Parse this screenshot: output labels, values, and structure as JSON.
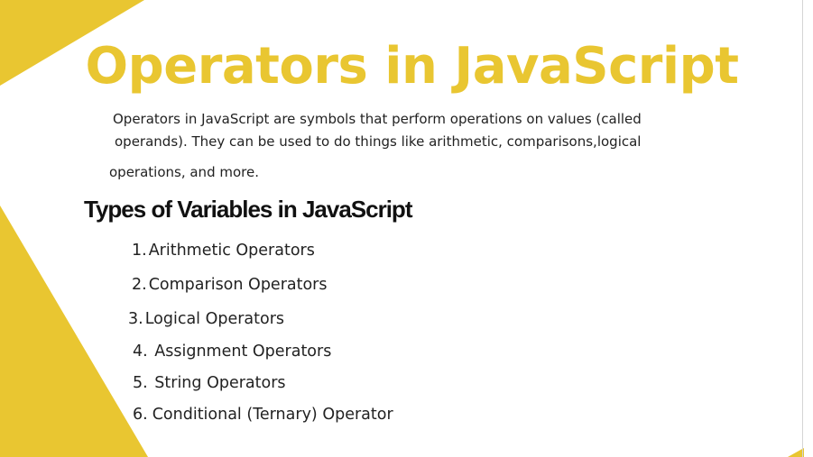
{
  "slide": {
    "title": "Operators in JavaScript",
    "intro_lines": [
      "Operators in JavaScript are symbols that perform operations on values (called",
      "operands). They can  be used to do things like arithmetic, comparisons,logical",
      "operations, and more."
    ],
    "subtitle": "Types of Variables in JavaScript",
    "items": [
      {
        "number": "1.",
        "label": "Arithmetic Operators"
      },
      {
        "number": "2.",
        "label": "Comparison Operators"
      },
      {
        "number": "3.",
        "label": "Logical Operators"
      },
      {
        "number": "4.",
        "label": "Assignment Operators"
      },
      {
        "number": "5.",
        "label": "String Operators"
      },
      {
        "number": "6.",
        "label": "Conditional (Ternary) Operator"
      }
    ]
  },
  "colors": {
    "accent": "#e9c631",
    "text": "#222222",
    "background": "#ffffff"
  }
}
